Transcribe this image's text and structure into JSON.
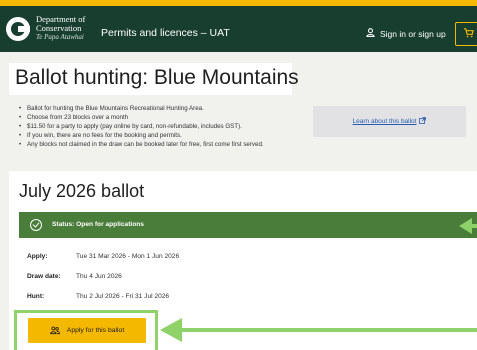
{
  "header": {
    "org_line1": "Department of",
    "org_line2": "Conservation",
    "org_maori": "Te Papa Atawhai",
    "app_title": "Permits and licences – UAT",
    "signin_label": "Sign in or sign up"
  },
  "page": {
    "title": "Ballot hunting: Blue Mountains",
    "intro_items": [
      "Ballot for hunting the Blue Mountains Recreational Hunting Area.",
      "Choose from 23 blocks over a month",
      "$11.50 for a party to apply (pay online by card, non-refundable, includes GST).",
      "If you win, there are no fees for the booking and permits.",
      "Any blocks not claimed in the draw can be booked later for free, first come first served."
    ],
    "learn_link": "Learn about this ballot"
  },
  "ballot": {
    "heading": "July 2026 ballot",
    "status": "Status: Open for applications",
    "details": [
      {
        "label": "Apply:",
        "value": "Tue 31 Mar 2026 - Mon 1 Jun 2026"
      },
      {
        "label": "Draw date:",
        "value": "Thu 4 Jun 2026"
      },
      {
        "label": "Hunt:",
        "value": "Thu 2 Jul 2026 - Fri 31 Jul 2026"
      }
    ],
    "apply_label": "Apply for this ballot"
  },
  "colors": {
    "brand_green": "#173e2f",
    "accent_yellow": "#f5b800",
    "status_green": "#4a7c3a",
    "annotation_green": "#8fd26a"
  },
  "icons": {
    "user": "user-icon",
    "cart": "cart-icon",
    "status": "check-circle-icon",
    "external": "external-link-icon",
    "apply": "person-group-icon"
  }
}
